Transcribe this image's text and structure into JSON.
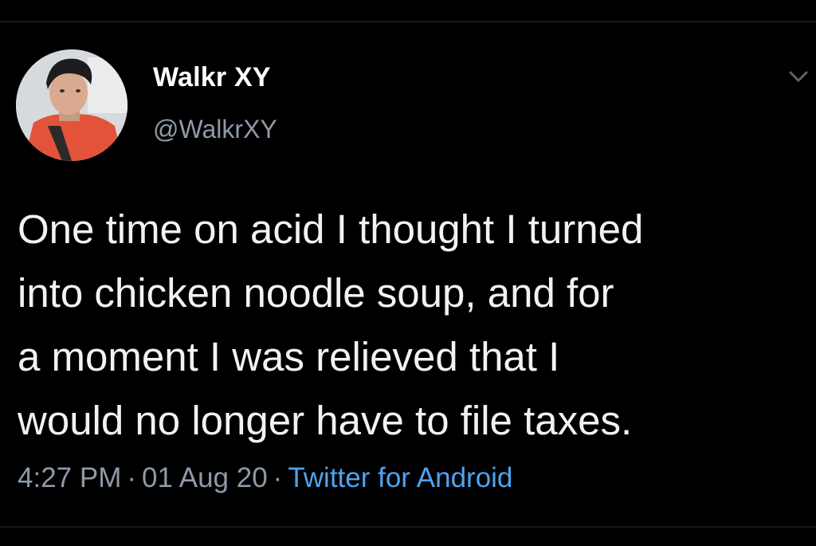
{
  "tweet": {
    "author": {
      "display_name": "Walkr XY",
      "handle": "@WalkrXY",
      "avatar_icon": "profile-photo"
    },
    "menu_icon": "chevron-down-icon",
    "text_lines": [
      "One time on acid I thought I turned",
      "into chicken noodle soup, and for",
      "a moment I was relieved that I",
      "would no longer have to file taxes."
    ],
    "meta": {
      "time": "4:27 PM",
      "separator": "·",
      "date": "01 Aug 20",
      "source": "Twitter for Android"
    }
  },
  "colors": {
    "background": "#000000",
    "text": "#f2f2f2",
    "secondary": "#8e9aa6",
    "link": "#4ea3f0"
  }
}
